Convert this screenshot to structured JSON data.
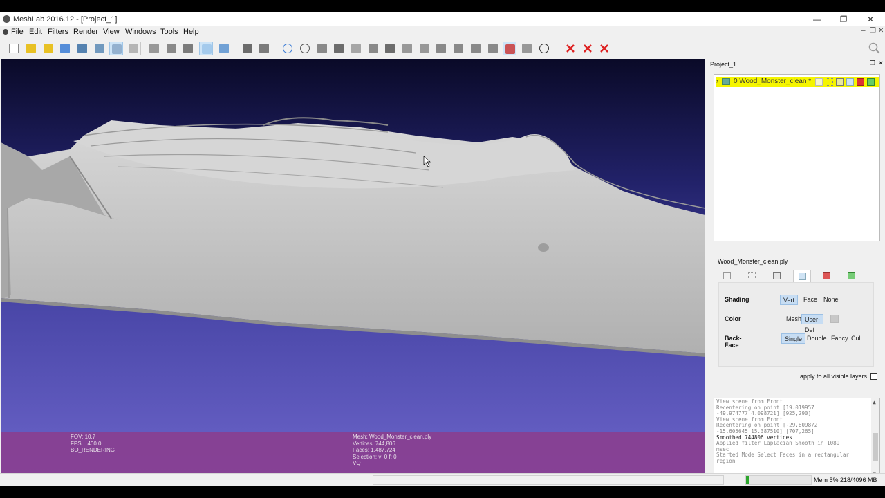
{
  "window": {
    "title": "MeshLab 2016.12 - [Project_1]",
    "minimize": "—",
    "maximize": "❐",
    "close": "✕"
  },
  "menu": {
    "items": [
      "File",
      "Edit",
      "Filters",
      "Render",
      "View",
      "Windows",
      "Tools",
      "Help"
    ],
    "mdi_controls": [
      "–",
      "❐",
      "✕"
    ]
  },
  "toolbar": {
    "icons": [
      "new-project-icon",
      "open-mesh-icon",
      "open-project-icon",
      "reload-icon",
      "save-icon",
      "snapshot-icon",
      "layers-icon",
      "raster-icon",
      "bounding-box-icon",
      "points-icon",
      "wireframe-icon",
      "smooth-icon",
      "flat-icon",
      "trackball-icon",
      "axes-icon",
      "globe-icon",
      "annotation-icon",
      "texture-icon",
      "measure-icon",
      "paint-icon",
      "select-icon",
      "brush-icon",
      "pickpoints-icon",
      "align-icon",
      "manipulator-icon",
      "fill-icon",
      "segment-icon",
      "quality-icon",
      "select-faces-icon",
      "select-vertices-icon",
      "info-icon",
      "delete-faces-icon",
      "delete-vertices-icon",
      "delete-selection-icon"
    ],
    "active": [
      "layers-icon",
      "smooth-icon",
      "select-faces-icon"
    ]
  },
  "viewport": {
    "info_left": [
      "FOV: 10.7",
      "FPS:   400.0",
      "BO_RENDERING"
    ],
    "info_right": [
      "Mesh: Wood_Monster_clean.ply",
      "Vertices: 744,806",
      "Faces: 1,487,724",
      "Selection: v: 0 f: 0",
      "VQ"
    ],
    "colors": {
      "mesh": "#c7c7c7",
      "sky_top": "#0a0a28",
      "sky_bottom": "#6a63c8",
      "infobar": "#8c3c8c"
    }
  },
  "project_panel": {
    "title": "Project_1",
    "layer": {
      "arrow": "›",
      "name": "0  Wood_Monster_clean *",
      "highlight": "#f5f500"
    }
  },
  "mesh_panel": {
    "filename": "Wood_Monster_clean.ply",
    "tabs": [
      "bbox-tab-icon",
      "points-tab-icon",
      "wire-tab-icon",
      "fill-tab-icon",
      "texture-tab-icon",
      "extra-tab-icon"
    ],
    "active_tab": "fill-tab-icon",
    "rows": [
      {
        "label": "Shading",
        "options": [
          "Vert",
          "Face",
          "None"
        ],
        "selected": "Vert"
      },
      {
        "label": "Color",
        "options": [
          "Mesh",
          "User-Def"
        ],
        "selected": "User-Def"
      },
      {
        "label": "Back-Face",
        "options": [
          "Single",
          "Double",
          "Fancy",
          "Cull"
        ],
        "selected": "Single"
      }
    ],
    "apply_all_label": "apply to all visible layers"
  },
  "log": {
    "lines": [
      "View scene from Front",
      "Recentering on point [19.019957",
      "-49.974777 4.098721] [925,290]",
      "View scene from Front",
      "Recentering on point [-29.809872",
      "-15.605645 15.387510] [707,265]",
      "Smoothed 744806 vertices",
      "Applied filter Laplacian Smooth in 1089",
      "msec",
      "Started Mode Select Faces in a rectangular",
      "region"
    ],
    "bold_index": 6
  },
  "status": {
    "memory": "Mem 5% 218/4096 MB",
    "memory_fraction": 0.05
  }
}
